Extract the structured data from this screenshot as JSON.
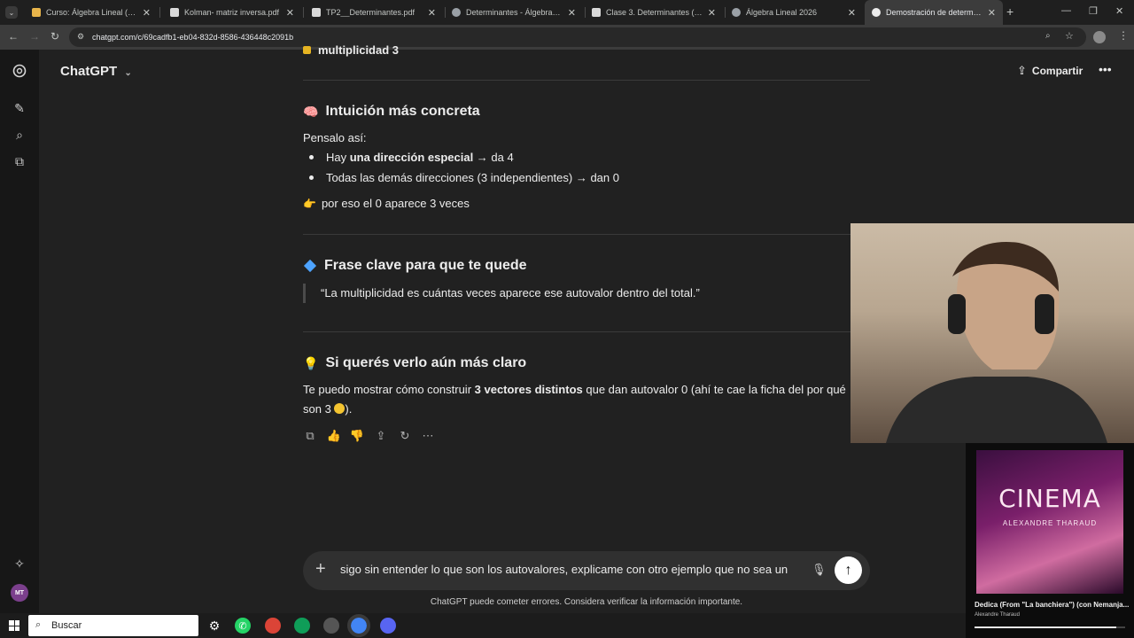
{
  "browser": {
    "tabs": [
      {
        "label": "Curso: Álgebra Lineal (1C 2026)",
        "active": false
      },
      {
        "label": "Kolman- matriz inversa.pdf",
        "active": false
      },
      {
        "label": "TP2__Determinantes.pdf",
        "active": false
      },
      {
        "label": "Determinantes - Álgebra Lineal",
        "active": false
      },
      {
        "label": "Clase 3. Determinantes (2).pdf",
        "active": false
      },
      {
        "label": "Álgebra Lineal 2026",
        "active": false
      },
      {
        "label": "Demostración de determinante",
        "active": true
      }
    ],
    "url": "chatgpt.com/c/69cadfb1-eb04-832d-8586-436448c2091b"
  },
  "header": {
    "model_name": "ChatGPT",
    "share_label": "Compartir"
  },
  "content": {
    "partial_top": "multiplicidad 3",
    "section1": {
      "heading": "Intuición más concreta",
      "intro": "Pensalo así:",
      "bullet1_pre": "Hay ",
      "bullet1_bold": "una dirección especial",
      "bullet1_post": " → da 4",
      "bullet2": "Todas las demás direcciones (3 independientes) → dan 0",
      "conclusion": "por eso el 0 aparece 3 veces"
    },
    "section2": {
      "heading": "Frase clave para que te quede",
      "quote": "“La multiplicidad es cuántas veces aparece ese autovalor dentro del total.”"
    },
    "section3": {
      "heading": "Si querés verlo aún más claro",
      "line1_pre": "Te puedo mostrar cómo construir ",
      "line1_bold": "3 vectores distintos",
      "line1_post": " que dan autovalor 0 (ahí te cae la ficha del por qué",
      "line2": "son 3 ",
      "line2_end": ")."
    }
  },
  "composer": {
    "text": "sigo sin entender lo que son los autovalores, explicame con otro ejemplo que no sea un",
    "disclaimer": "ChatGPT puede cometer errores. Considera verificar la información importante."
  },
  "rail": {
    "avatar_initials": "MT"
  },
  "music": {
    "album_title": "CINEMA",
    "album_artist": "ALEXANDRE THARAUD",
    "song_title": "Dedica (From \"La banchiera\") (con Nemanja...",
    "song_artist": "Alexandre Tharaud",
    "progress": 0.94
  },
  "taskbar": {
    "search_placeholder": "Buscar"
  },
  "colors": {
    "background": "#212121",
    "sidebar": "#171717",
    "composer": "#303030",
    "accent_blue_diamond": "#4da3ff"
  }
}
